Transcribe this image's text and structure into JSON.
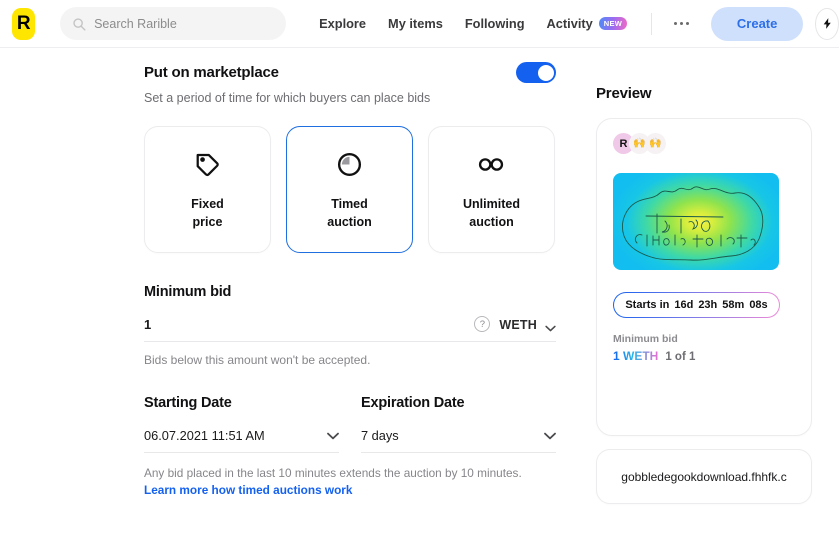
{
  "header": {
    "logo_text": "R",
    "search": {
      "placeholder": "Search Rarible",
      "value": ""
    },
    "nav": [
      {
        "label": "Explore",
        "badge": null
      },
      {
        "label": "My items",
        "badge": null
      },
      {
        "label": "Following",
        "badge": null
      },
      {
        "label": "Activity",
        "badge": "NEW"
      }
    ],
    "more_label": "",
    "create_label": "Create"
  },
  "form": {
    "section_title": "Put on marketplace",
    "section_subtitle": "Set a period of time for which buyers can place bids",
    "toggle_on": true,
    "options": [
      {
        "label_line1": "Fixed",
        "label_line2": "price",
        "icon": "price-tag-icon",
        "selected": false
      },
      {
        "label_line1": "Timed",
        "label_line2": "auction",
        "icon": "timer-icon",
        "selected": true
      },
      {
        "label_line1": "Unlimited",
        "label_line2": "auction",
        "icon": "infinity-icon",
        "selected": false
      }
    ],
    "minimum_bid": {
      "title": "Minimum bid",
      "value": "1",
      "currency": "WETH",
      "hint": "Bids below this amount won't be accepted."
    },
    "starting_date": {
      "label": "Starting Date",
      "value": "06.07.2021 11:51 AM"
    },
    "expiration_date": {
      "label": "Expiration Date",
      "value": "7 days"
    },
    "footer_note": "Any bid placed in the last 10 minutes extends the auction by 10 minutes.",
    "footer_link": "Learn more how timed auctions work"
  },
  "preview": {
    "title": "Preview",
    "avatars": [
      "R",
      "🙌",
      "🙌"
    ],
    "countdown_prefix": "Starts in",
    "countdown_days": "16d",
    "countdown_hours": "23h",
    "countdown_minutes": "58m",
    "countdown_seconds": "08s",
    "minimum_bid_label": "Minimum bid",
    "bid_amount": "1 WETH",
    "bid_edition": "1 of 1",
    "file_name": "gobbledegookdownload.fhhfk.c"
  },
  "colors": {
    "accent_blue": "#1461f0",
    "logo_yellow": "#ffe600",
    "create_bg": "#cfe0fc",
    "create_text": "#2c6fe8"
  }
}
